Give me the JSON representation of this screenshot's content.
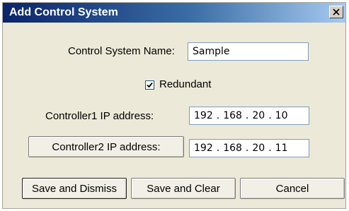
{
  "window": {
    "title": "Add Control System"
  },
  "form": {
    "name_label": "Control System Name:",
    "name_value": "Sample",
    "redundant_label": "Redundant",
    "redundant_checked": true,
    "controller1_label": "Controller1 IP address:",
    "controller1_ip": [
      "192",
      "168",
      "20",
      "10"
    ],
    "controller2_button_label": "Controller2 IP address:",
    "controller2_ip": [
      "192",
      "168",
      "20",
      "11"
    ]
  },
  "buttons": {
    "save_dismiss": "Save and Dismiss",
    "save_clear": "Save and Clear",
    "cancel": "Cancel"
  },
  "icons": {
    "close": "close-icon",
    "check": "checkmark-icon"
  },
  "colors": {
    "titlebar_start": "#0a246a",
    "titlebar_end": "#a6caf0",
    "dialog_bg": "#ece9d8"
  }
}
